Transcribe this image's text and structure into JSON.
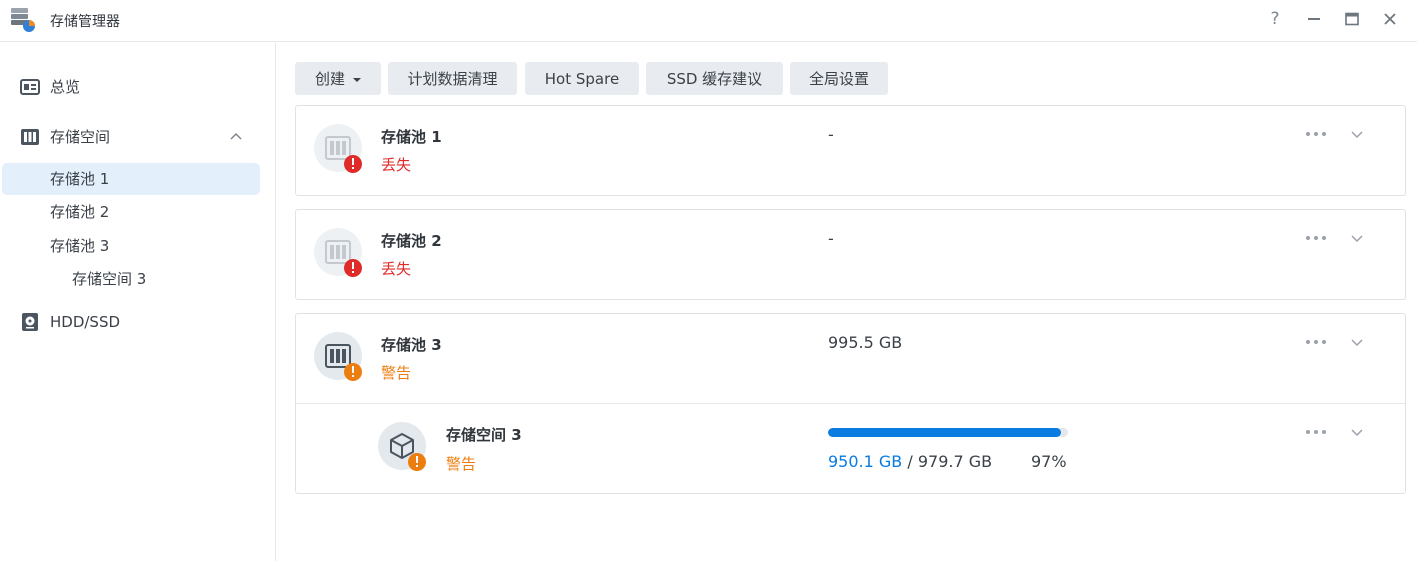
{
  "app": {
    "title": "存储管理器"
  },
  "window": {
    "help": "?"
  },
  "sidebar": {
    "overview": "总览",
    "storage": "存储空间",
    "pools": [
      "存储池 1",
      "存储池 2",
      "存储池 3"
    ],
    "volume": "存储空间 3",
    "hdd": "HDD/SSD",
    "active_item": "存储池 1"
  },
  "toolbar": {
    "create": "创建",
    "scrub": "计划数据清理",
    "hot_spare": "Hot Spare",
    "ssd_cache": "SSD 缓存建议",
    "global": "全局设置"
  },
  "pools": [
    {
      "name": "存储池 1",
      "status": "丢失",
      "status_type": "lost",
      "size": "-"
    },
    {
      "name": "存储池 2",
      "status": "丢失",
      "status_type": "lost",
      "size": "-"
    },
    {
      "name": "存储池 3",
      "status": "警告",
      "status_type": "warning",
      "size": "995.5 GB"
    }
  ],
  "volume": {
    "name": "存储空间 3",
    "status": "警告",
    "used": "950.1 GB",
    "separator": "/",
    "total": "979.7 GB",
    "percent_label": "97%",
    "usage_fraction": 0.97
  },
  "colors": {
    "accent": "#0a7be0",
    "lost": "#e02b2b",
    "warning": "#ec7e10",
    "active_nav": "#e3f0fc"
  }
}
